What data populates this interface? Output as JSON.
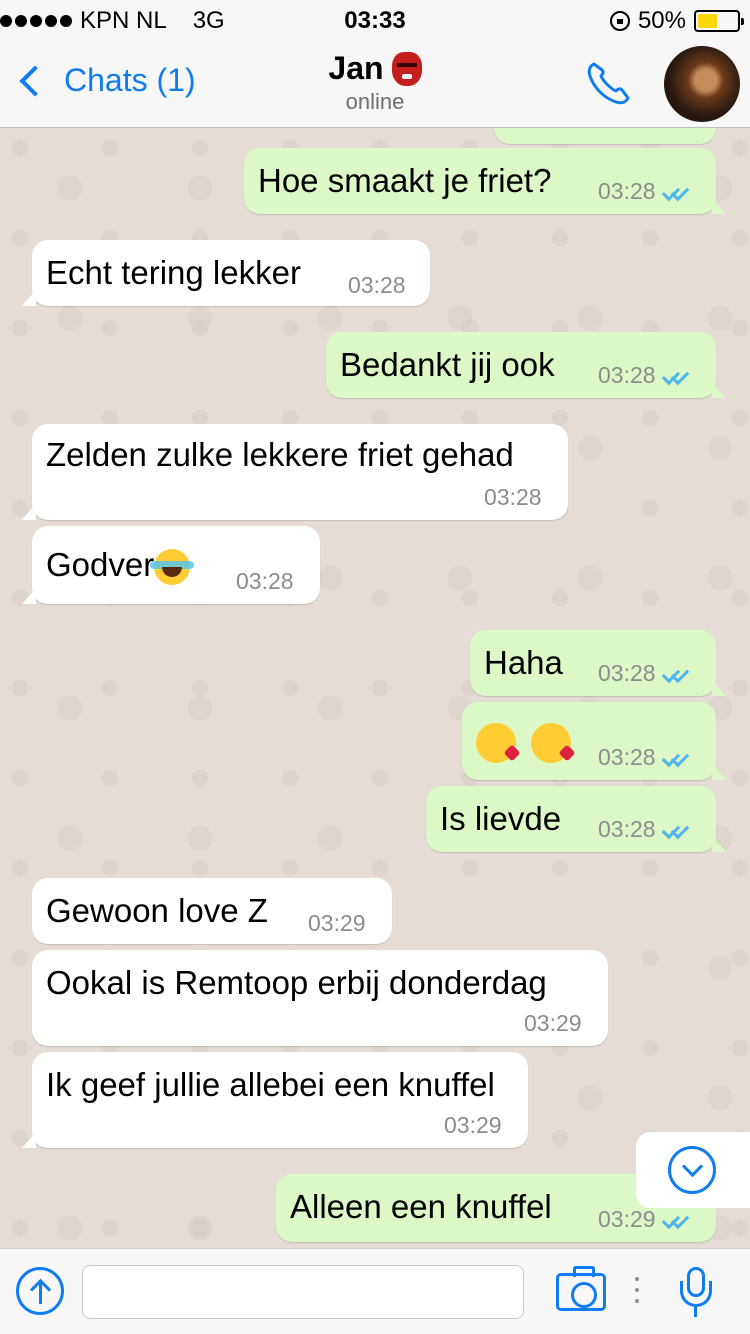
{
  "status_bar": {
    "carrier": "KPN NL",
    "network": "3G",
    "time": "03:33",
    "battery_percent": "50%",
    "battery_level": 0.5
  },
  "header": {
    "back_label": "Chats (1)",
    "contact_name": "Jan",
    "contact_status": "online",
    "contact_emoji": "japanese-ogre-icon"
  },
  "messages": [
    {
      "direction": "out",
      "text": "Hoe smaakt je friet?",
      "time": "03:28",
      "read": true
    },
    {
      "direction": "in",
      "text": "Echt tering lekker",
      "time": "03:28"
    },
    {
      "direction": "out",
      "text": "Bedankt jij ook",
      "time": "03:28",
      "read": true
    },
    {
      "direction": "in",
      "text": "Zelden zulke lekkere friet gehad",
      "time": "03:28"
    },
    {
      "direction": "in",
      "text": "Godver",
      "emoji": "laughing-tears-icon",
      "time": "03:28"
    },
    {
      "direction": "out",
      "text": "Haha",
      "time": "03:28",
      "read": true
    },
    {
      "direction": "out",
      "text": "",
      "emoji": "kissing-heart-icon x2",
      "time": "03:28",
      "read": true
    },
    {
      "direction": "out",
      "text": "Is lievde",
      "time": "03:28",
      "read": true
    },
    {
      "direction": "in",
      "text": "Gewoon love Z",
      "time": "03:29"
    },
    {
      "direction": "in",
      "text": "Ookal is Remtoop erbij donderdag",
      "time": "03:29"
    },
    {
      "direction": "in",
      "text": "Ik geef jullie allebei een knuffel",
      "time": "03:29"
    },
    {
      "direction": "out",
      "text": "Alleen een knuffel",
      "time": "03:29",
      "read": true
    }
  ],
  "input": {
    "value": "",
    "placeholder": ""
  },
  "colors": {
    "accent": "#0f7cf2",
    "outgoing_bubble": "#dcf8c6",
    "incoming_bubble": "#ffffff",
    "read_ticks": "#4fb5ec",
    "chat_background": "#e5ddd5"
  }
}
